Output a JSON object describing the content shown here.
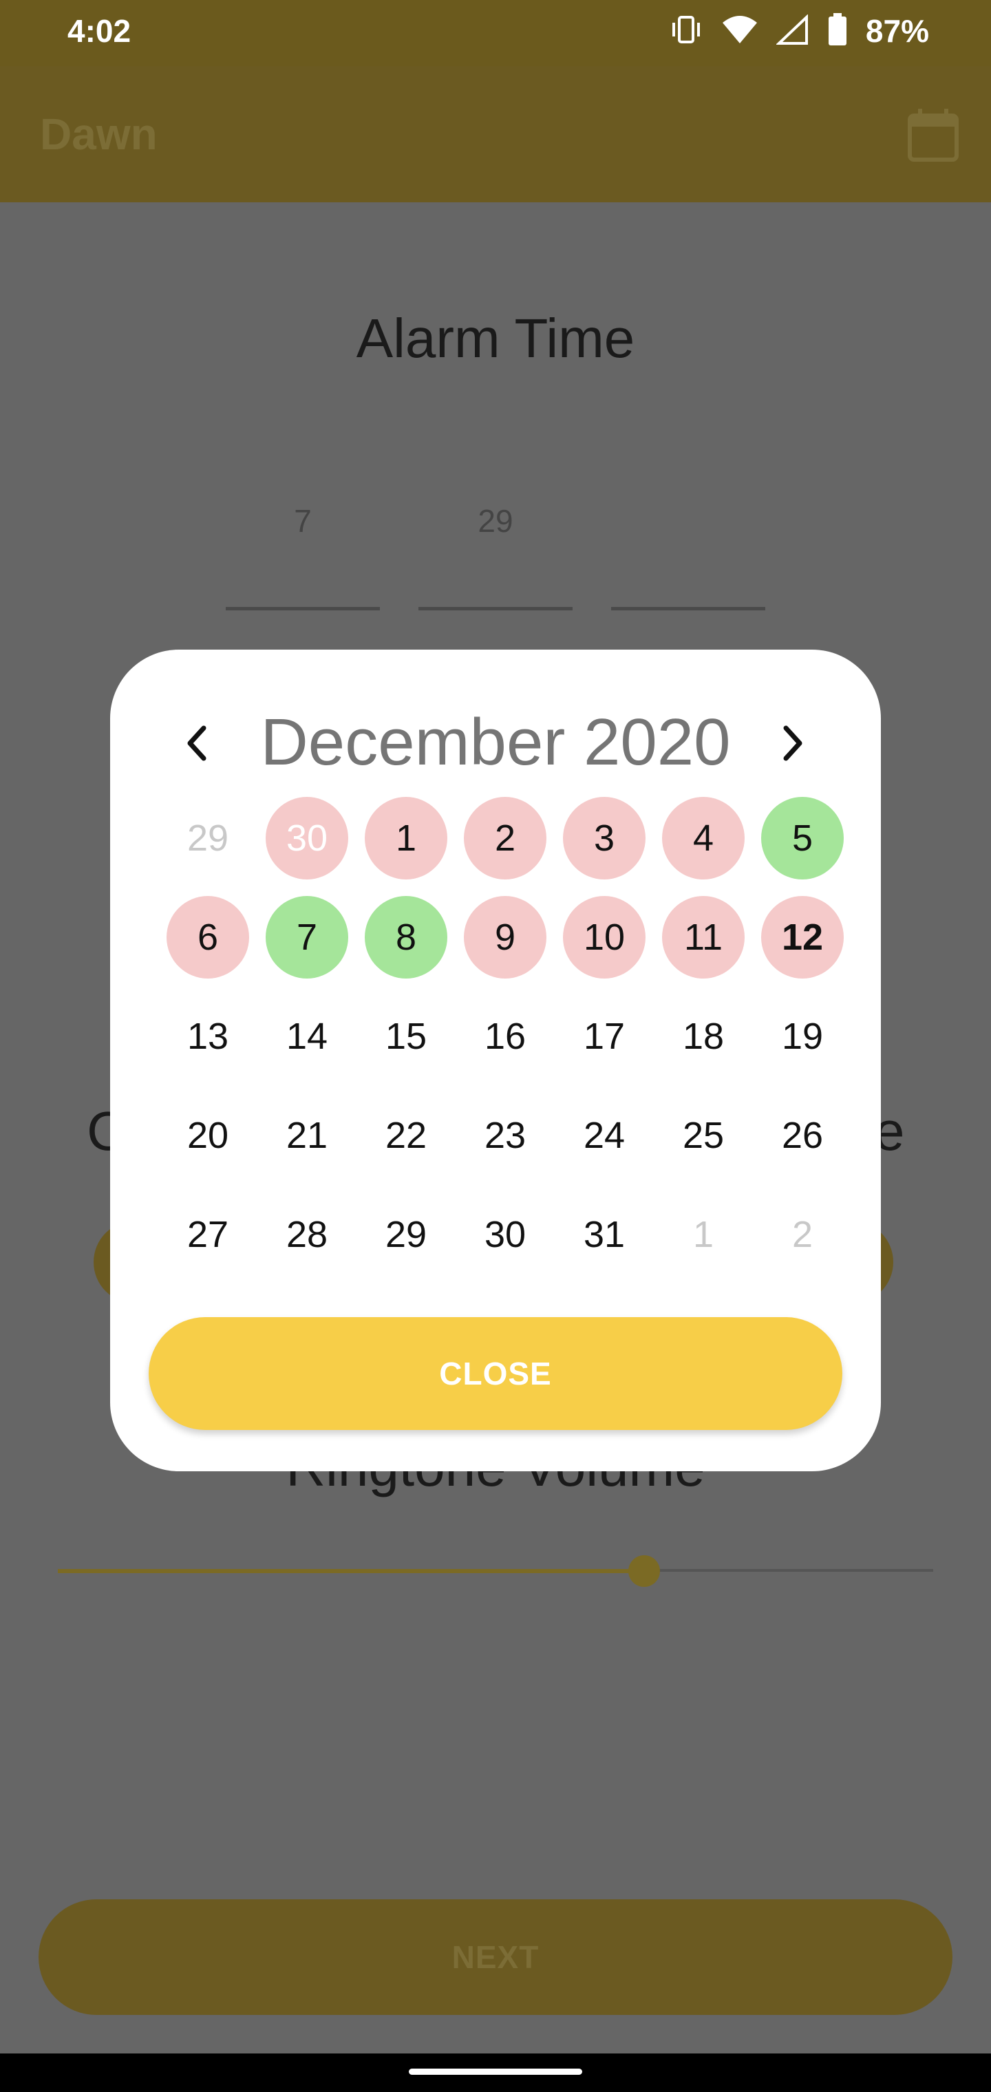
{
  "status_bar": {
    "time": "4:02",
    "battery_percent": "87%"
  },
  "app_bar": {
    "title": "Dawn"
  },
  "main": {
    "title": "Alarm Time",
    "time_fields": [
      "7",
      "29",
      ""
    ],
    "partial_left": "C",
    "partial_right": "e",
    "volume_label": "Ringtone Volume",
    "volume_level": 0.67
  },
  "next_label": "NEXT",
  "calendar": {
    "month_title": "December 2020",
    "days": [
      {
        "label": "29",
        "style": "muted"
      },
      {
        "label": "30",
        "style": "pink muted"
      },
      {
        "label": "1",
        "style": "pink"
      },
      {
        "label": "2",
        "style": "pink"
      },
      {
        "label": "3",
        "style": "pink"
      },
      {
        "label": "4",
        "style": "pink"
      },
      {
        "label": "5",
        "style": "green"
      },
      {
        "label": "6",
        "style": "pink"
      },
      {
        "label": "7",
        "style": "green"
      },
      {
        "label": "8",
        "style": "green"
      },
      {
        "label": "9",
        "style": "pink"
      },
      {
        "label": "10",
        "style": "pink"
      },
      {
        "label": "11",
        "style": "pink"
      },
      {
        "label": "12",
        "style": "pink today"
      },
      {
        "label": "13",
        "style": ""
      },
      {
        "label": "14",
        "style": ""
      },
      {
        "label": "15",
        "style": ""
      },
      {
        "label": "16",
        "style": ""
      },
      {
        "label": "17",
        "style": ""
      },
      {
        "label": "18",
        "style": ""
      },
      {
        "label": "19",
        "style": ""
      },
      {
        "label": "20",
        "style": ""
      },
      {
        "label": "21",
        "style": ""
      },
      {
        "label": "22",
        "style": ""
      },
      {
        "label": "23",
        "style": ""
      },
      {
        "label": "24",
        "style": ""
      },
      {
        "label": "25",
        "style": ""
      },
      {
        "label": "26",
        "style": ""
      },
      {
        "label": "27",
        "style": ""
      },
      {
        "label": "28",
        "style": ""
      },
      {
        "label": "29",
        "style": ""
      },
      {
        "label": "30",
        "style": ""
      },
      {
        "label": "31",
        "style": ""
      },
      {
        "label": "1",
        "style": "muted"
      },
      {
        "label": "2",
        "style": "muted"
      }
    ],
    "close_label": "CLOSE"
  },
  "colors": {
    "accent": "#f7ce48",
    "event_pink": "#f5caca",
    "event_green": "#a5e59a"
  }
}
